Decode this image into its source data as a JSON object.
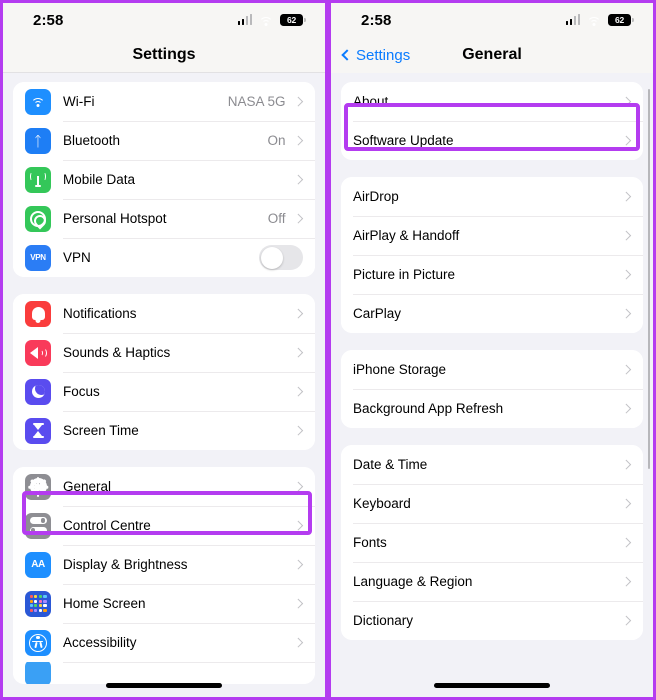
{
  "status": {
    "time": "2:58",
    "battery_level": "62",
    "signal_icon": "cellular-signal-icon",
    "wifi_icon": "wifi-icon",
    "battery_icon": "battery-icon"
  },
  "left_screen": {
    "title": "Settings",
    "groups": [
      {
        "rows": [
          {
            "label": "Wi-Fi",
            "value": "NASA 5G",
            "icon": "wifi-icon",
            "accessory": "chevron"
          },
          {
            "label": "Bluetooth",
            "value": "On",
            "icon": "bluetooth-icon",
            "accessory": "chevron"
          },
          {
            "label": "Mobile Data",
            "value": "",
            "icon": "cellular-icon",
            "accessory": "chevron"
          },
          {
            "label": "Personal Hotspot",
            "value": "Off",
            "icon": "hotspot-icon",
            "accessory": "chevron"
          },
          {
            "label": "VPN",
            "value": "",
            "icon": "vpn-icon",
            "accessory": "toggle",
            "toggle_on": false
          }
        ]
      },
      {
        "rows": [
          {
            "label": "Notifications",
            "value": "",
            "icon": "notifications-bell-icon",
            "accessory": "chevron"
          },
          {
            "label": "Sounds & Haptics",
            "value": "",
            "icon": "speaker-icon",
            "accessory": "chevron"
          },
          {
            "label": "Focus",
            "value": "",
            "icon": "moon-icon",
            "accessory": "chevron"
          },
          {
            "label": "Screen Time",
            "value": "",
            "icon": "hourglass-icon",
            "accessory": "chevron"
          }
        ]
      },
      {
        "rows": [
          {
            "label": "General",
            "value": "",
            "icon": "gear-icon",
            "accessory": "chevron",
            "highlighted": true
          },
          {
            "label": "Control Centre",
            "value": "",
            "icon": "control-centre-icon",
            "accessory": "chevron"
          },
          {
            "label": "Display & Brightness",
            "value": "",
            "icon": "display-brightness-icon",
            "accessory": "chevron"
          },
          {
            "label": "Home Screen",
            "value": "",
            "icon": "home-screen-grid-icon",
            "accessory": "chevron"
          },
          {
            "label": "Accessibility",
            "value": "",
            "icon": "accessibility-icon",
            "accessory": "chevron"
          }
        ]
      }
    ]
  },
  "right_screen": {
    "back_label": "Settings",
    "title": "General",
    "groups": [
      {
        "rows": [
          {
            "label": "About",
            "highlighted": true
          },
          {
            "label": "Software Update"
          }
        ]
      },
      {
        "rows": [
          {
            "label": "AirDrop"
          },
          {
            "label": "AirPlay & Handoff"
          },
          {
            "label": "Picture in Picture"
          },
          {
            "label": "CarPlay"
          }
        ]
      },
      {
        "rows": [
          {
            "label": "iPhone Storage"
          },
          {
            "label": "Background App Refresh"
          }
        ]
      },
      {
        "rows": [
          {
            "label": "Date & Time"
          },
          {
            "label": "Keyboard"
          },
          {
            "label": "Fonts"
          },
          {
            "label": "Language & Region"
          },
          {
            "label": "Dictionary"
          }
        ]
      }
    ]
  },
  "colors": {
    "highlight": "#b43cf0",
    "accent_blue": "#0a7cff",
    "group_background": "#ffffff",
    "page_background": "#f2f2f7"
  }
}
